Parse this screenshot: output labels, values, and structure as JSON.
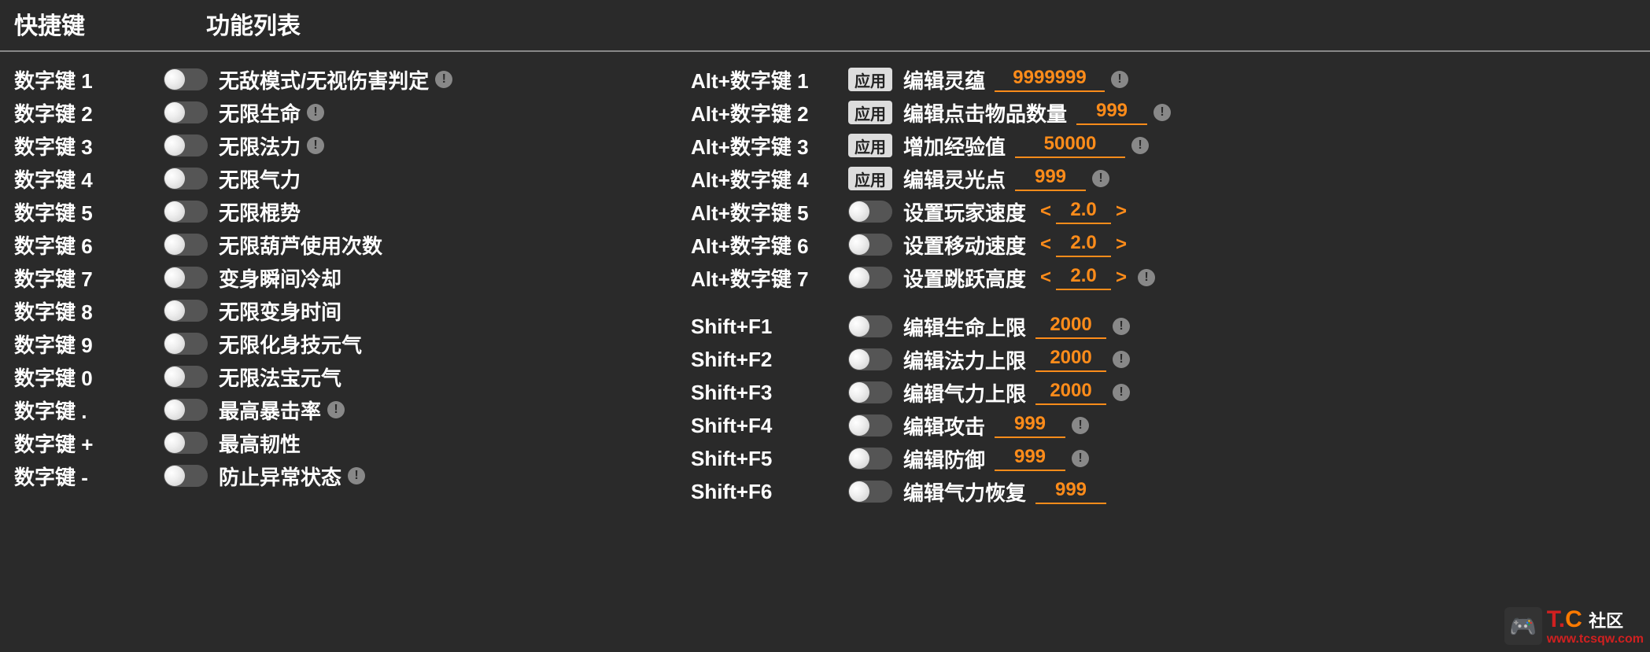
{
  "header": {
    "hotkey": "快捷键",
    "funclist": "功能列表"
  },
  "apply_label": "应用",
  "info_glyph": "!",
  "left": [
    {
      "key": "数字键 1",
      "label": "无敌模式/无视伤害判定",
      "info": true
    },
    {
      "key": "数字键 2",
      "label": "无限生命",
      "info": true
    },
    {
      "key": "数字键 3",
      "label": "无限法力",
      "info": true
    },
    {
      "key": "数字键 4",
      "label": "无限气力",
      "info": false
    },
    {
      "key": "数字键 5",
      "label": "无限棍势",
      "info": false
    },
    {
      "key": "数字键 6",
      "label": "无限葫芦使用次数",
      "info": false
    },
    {
      "key": "数字键 7",
      "label": "变身瞬间冷却",
      "info": false
    },
    {
      "key": "数字键 8",
      "label": "无限变身时间",
      "info": false
    },
    {
      "key": "数字键 9",
      "label": "无限化身技元气",
      "info": false
    },
    {
      "key": "数字键 0",
      "label": "无限法宝元气",
      "info": false
    },
    {
      "key": "数字键 .",
      "label": "最高暴击率",
      "info": true
    },
    {
      "key": "数字键 +",
      "label": "最高韧性",
      "info": false
    },
    {
      "key": "数字键 -",
      "label": "防止异常状态",
      "info": true
    }
  ],
  "right_a": [
    {
      "key": "Alt+数字键 1",
      "type": "apply",
      "label": "编辑灵蕴",
      "value": "9999999",
      "wide": true,
      "info": true
    },
    {
      "key": "Alt+数字键 2",
      "type": "apply",
      "label": "编辑点击物品数量",
      "value": "999",
      "wide": false,
      "info": true
    },
    {
      "key": "Alt+数字键 3",
      "type": "apply",
      "label": "增加经验值",
      "value": "50000",
      "wide": true,
      "info": true
    },
    {
      "key": "Alt+数字键 4",
      "type": "apply",
      "label": "编辑灵光点",
      "value": "999",
      "wide": false,
      "info": true
    },
    {
      "key": "Alt+数字键 5",
      "type": "toggle_step",
      "label": "设置玩家速度",
      "value": "2.0",
      "info": false
    },
    {
      "key": "Alt+数字键 6",
      "type": "toggle_step",
      "label": "设置移动速度",
      "value": "2.0",
      "info": false
    },
    {
      "key": "Alt+数字键 7",
      "type": "toggle_step",
      "label": "设置跳跃高度",
      "value": "2.0",
      "info": true
    }
  ],
  "right_b": [
    {
      "key": "Shift+F1",
      "type": "toggle_val",
      "label": "编辑生命上限",
      "value": "2000",
      "info": true
    },
    {
      "key": "Shift+F2",
      "type": "toggle_val",
      "label": "编辑法力上限",
      "value": "2000",
      "info": true
    },
    {
      "key": "Shift+F3",
      "type": "toggle_val",
      "label": "编辑气力上限",
      "value": "2000",
      "info": true
    },
    {
      "key": "Shift+F4",
      "type": "toggle_val",
      "label": "编辑攻击",
      "value": "999",
      "info": true
    },
    {
      "key": "Shift+F5",
      "type": "toggle_val",
      "label": "编辑防御",
      "value": "999",
      "info": true
    },
    {
      "key": "Shift+F6",
      "type": "toggle_val",
      "label": "编辑气力恢复",
      "value": "999",
      "info": false
    }
  ],
  "watermark": {
    "logo_t": "T",
    "logo_dot": ".",
    "logo_c": "C",
    "sub": "社区",
    "url": "www.tcsqw.com"
  }
}
